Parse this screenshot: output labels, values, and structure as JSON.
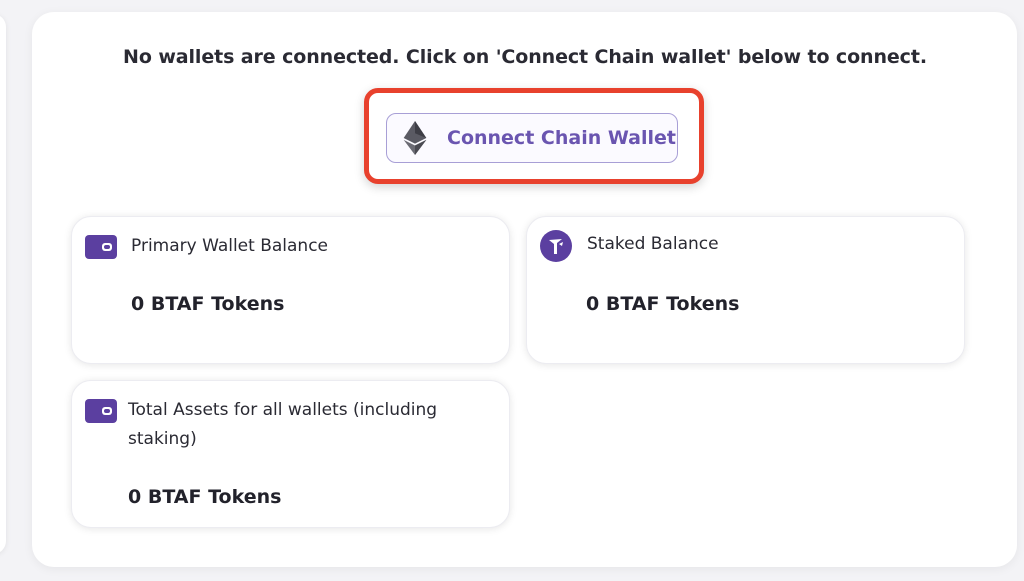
{
  "notice": "No wallets are connected. Click on 'Connect Chain wallet' below to connect.",
  "connect_button": {
    "label": "Connect Chain Wallet",
    "icon": "ethereum-icon"
  },
  "cards": {
    "primary": {
      "title": "Primary Wallet Balance",
      "value": "0 BTAF Tokens",
      "icon": "wallet-icon"
    },
    "staked": {
      "title": "Staked Balance",
      "value": "0 BTAF Tokens",
      "icon": "stake-icon"
    },
    "total": {
      "title": "Total Assets for all wallets (including staking)",
      "value": "0 BTAF Tokens",
      "icon": "wallet-icon"
    }
  },
  "colors": {
    "accent": "#5b3fa0",
    "button_text": "#6a55b0",
    "highlight": "#e8412d"
  }
}
